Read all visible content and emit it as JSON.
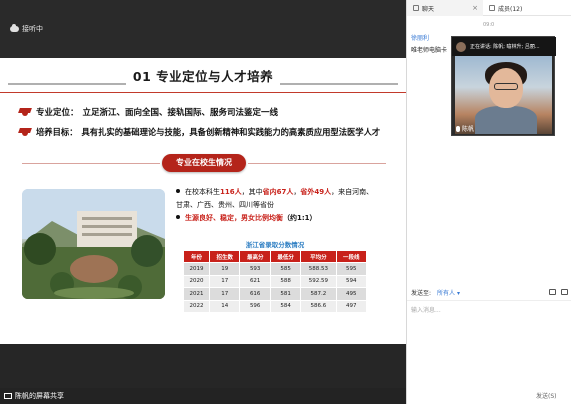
{
  "share": {
    "status": "接听中",
    "bottom_label": "陈帆的屏幕共享"
  },
  "slide": {
    "title": "01 专业定位与人才培养",
    "bullets": [
      {
        "label": "专业定位：",
        "text": "立足浙江、面向全国、接轨国际、服务司法鉴定一线"
      },
      {
        "label": "培养目标：",
        "text": "具有扎实的基础理论与技能，具备创新精神和实践能力的高素质应用型法医学人才"
      }
    ],
    "section_pill": "专业在校生情况",
    "info": {
      "line1_prefix": "在校本科生",
      "line1_total": "116人",
      "line1_mid": "，其中",
      "line1_in": "省内67人",
      "line1_sep": "，",
      "line1_out": "省外49人",
      "line1_suffix": "，来自河南、",
      "line2": "甘肃、广西、贵州、四川等省份",
      "line3_red": "生源良好、稳定，男女比例均衡",
      "line3_ratio": "（约1:1）"
    },
    "table_title": "浙江省录取分数情况",
    "table_headers": [
      "年份",
      "招生数",
      "最高分",
      "最低分",
      "平均分",
      "一段线"
    ],
    "table_rows": [
      [
        "2019",
        "19",
        "593",
        "585",
        "588.53",
        "595"
      ],
      [
        "2020",
        "17",
        "621",
        "588",
        "592.59",
        "594"
      ],
      [
        "2021",
        "17",
        "616",
        "581",
        "587.2",
        "495"
      ],
      [
        "2022",
        "14",
        "596",
        "584",
        "586.6",
        "497"
      ]
    ]
  },
  "chat": {
    "tabs": [
      {
        "label": "聊天",
        "icon": "chat-icon"
      },
      {
        "label": "成员(12)",
        "icon": "members-icon"
      }
    ],
    "time": "09:0",
    "sender": "徐丽利",
    "message": "唯老师电脑卡",
    "video": {
      "speaking": "正在讲话: 陈帆; 喻林升; 吕丽...",
      "name": "陈帆"
    },
    "send_to_label": "发送至:",
    "recipient": "所有人",
    "input_placeholder": "输入消息...",
    "send_label": "发送(S)"
  },
  "colors": {
    "accent_red": "#c8211a",
    "link_blue": "#3a7bd5",
    "table_title_blue": "#2f7fc3"
  }
}
